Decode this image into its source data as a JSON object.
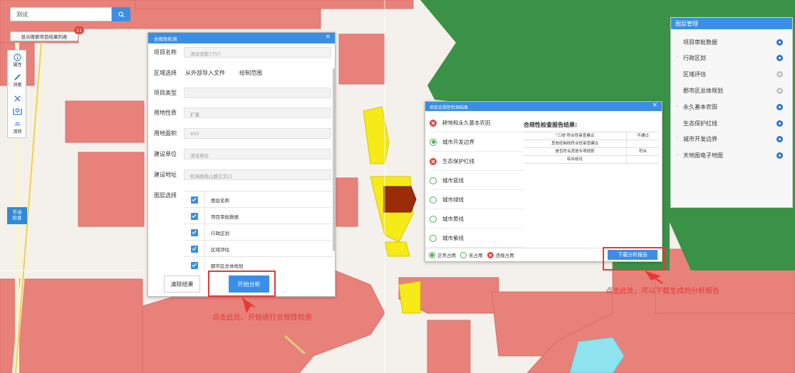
{
  "search": {
    "value": "测试",
    "button_icon": "search-icon",
    "show_results_label": "显示搜索项目结果列表",
    "results_count": "11"
  },
  "toolbar": {
    "items": [
      {
        "label": "属性",
        "icon": "info-icon"
      },
      {
        "label": "测量",
        "icon": "ruler-icon"
      },
      {
        "label": "",
        "icon": "pointer-icon"
      },
      {
        "label": "",
        "icon": "locate-icon"
      },
      {
        "label": "清除",
        "icon": "eraser-icon"
      }
    ],
    "manual_select": "手动\n检查"
  },
  "compliance_dialog": {
    "title": "合规性检测",
    "fields": [
      {
        "label": "项目名称",
        "value": "测试流程1757"
      },
      {
        "label": "项目类型",
        "value": ""
      },
      {
        "label": "用地性质",
        "value": "扩建"
      },
      {
        "label": "用地面积",
        "value": "455"
      },
      {
        "label": "建设单位",
        "value": "测试单位"
      },
      {
        "label": "建设地址",
        "value": "航海路嵩山路交叉口"
      }
    ],
    "region_label": "区域选择",
    "region_options": [
      "从外部导入文件",
      "绘制范围"
    ],
    "layer_select_label": "图层选择",
    "layers": [
      "图层名称",
      "项目审批数据",
      "行政区划",
      "区域评估",
      "郡市区总体规划"
    ],
    "clear_button": "清除结果",
    "analyze_button": "开始分析"
  },
  "results_dialog": {
    "title": "项目合规性检测结果",
    "zones": [
      {
        "label": "耕地和永久基本农田",
        "status": "violation"
      },
      {
        "label": "城市开发边界",
        "status": "normal"
      },
      {
        "label": "生态保护红线",
        "status": "violation"
      },
      {
        "label": "城市蓝线",
        "status": "none"
      },
      {
        "label": "城市绿线",
        "status": "none"
      },
      {
        "label": "城市黄线",
        "status": "none"
      },
      {
        "label": "城市紫线",
        "status": "none"
      }
    ],
    "report_title": "合规性检查报告结果:",
    "report_rows": [
      {
        "item": "\"三线\"符合性审查建议",
        "result": "不通过"
      },
      {
        "item": "其他控制线符合性审查建议",
        "result": ""
      },
      {
        "item": "是否符合其他专项规划",
        "result": "符合"
      },
      {
        "item": "综合结论",
        "result": ""
      }
    ],
    "legend": [
      "正常占用",
      "无占用",
      "违规占用"
    ],
    "download_button": "下载分析报告"
  },
  "layer_panel": {
    "title": "图层管理",
    "items": [
      {
        "label": "项目审批数据",
        "expandable": false,
        "visible": true
      },
      {
        "label": "行政区划",
        "expandable": true,
        "visible": true
      },
      {
        "label": "区域评估",
        "expandable": false,
        "visible": false
      },
      {
        "label": "郡市区总体规划",
        "expandable": false,
        "visible": false
      },
      {
        "label": "永久基本农田",
        "expandable": true,
        "visible": true
      },
      {
        "label": "生态保护红线",
        "expandable": false,
        "visible": true
      },
      {
        "label": "城市开发边界",
        "expandable": true,
        "visible": true
      },
      {
        "label": "天地图电子地图",
        "expandable": true,
        "visible": true
      }
    ]
  },
  "annotations": {
    "left": "点击此处，开始进行合规性检查",
    "right": "点击此处，可以下载生成的分析报告"
  },
  "colors": {
    "accent": "#3a8ee6",
    "annotation": "#e53935",
    "map_pink": "#e8817a",
    "map_green": "#3a9247",
    "map_yellow": "#f6ea18",
    "map_brown": "#9b2c0a"
  }
}
